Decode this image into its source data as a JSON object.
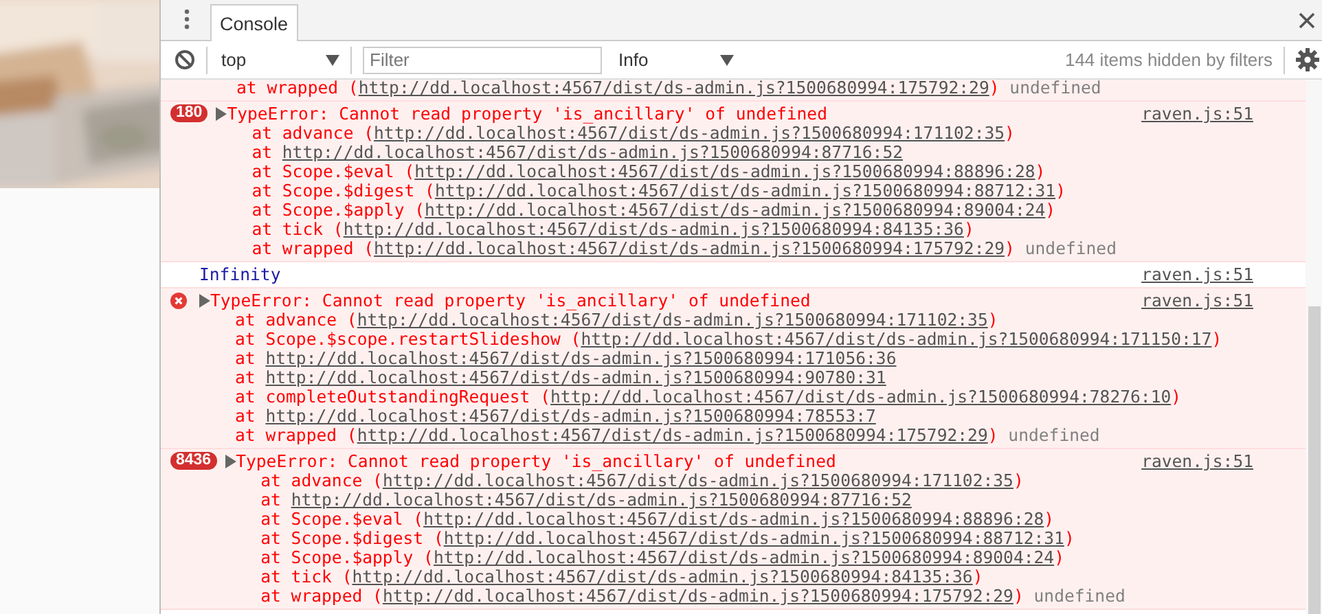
{
  "tabs": [
    {
      "label": "Console",
      "selected": true
    }
  ],
  "toolbar": {
    "context": "top",
    "filter_placeholder": "Filter",
    "level": "Info",
    "hidden_count": "144 items hidden by filters"
  },
  "messages": [
    {
      "kind": "partial",
      "frames": [
        {
          "text": "at wrapped (",
          "url": "http://dd.localhost:4567/dist/ds-admin.js?1500680994:175792:29",
          "close": ")"
        }
      ],
      "result": "undefined"
    },
    {
      "kind": "error",
      "count": "180",
      "message": "TypeError: Cannot read property 'is_ancillary' of undefined",
      "source": "raven.js:51",
      "frames": [
        {
          "text": "at advance (",
          "url": "http://dd.localhost:4567/dist/ds-admin.js?1500680994:171102:35",
          "close": ")"
        },
        {
          "text": "at ",
          "url": "http://dd.localhost:4567/dist/ds-admin.js?1500680994:87716:52"
        },
        {
          "text": "at Scope.$eval (",
          "url": "http://dd.localhost:4567/dist/ds-admin.js?1500680994:88896:28",
          "close": ")"
        },
        {
          "text": "at Scope.$digest (",
          "url": "http://dd.localhost:4567/dist/ds-admin.js?1500680994:88712:31",
          "close": ")"
        },
        {
          "text": "at Scope.$apply (",
          "url": "http://dd.localhost:4567/dist/ds-admin.js?1500680994:89004:24",
          "close": ")"
        },
        {
          "text": "at tick (",
          "url": "http://dd.localhost:4567/dist/ds-admin.js?1500680994:84135:36",
          "close": ")"
        },
        {
          "text": "at wrapped (",
          "url": "http://dd.localhost:4567/dist/ds-admin.js?1500680994:175792:29",
          "close": ")"
        }
      ],
      "result": "undefined"
    },
    {
      "kind": "log",
      "message": "Infinity",
      "source": "raven.js:51"
    },
    {
      "kind": "error",
      "message": "TypeError: Cannot read property 'is_ancillary' of undefined",
      "source": "raven.js:51",
      "frames": [
        {
          "text": "at advance (",
          "url": "http://dd.localhost:4567/dist/ds-admin.js?1500680994:171102:35",
          "close": ")"
        },
        {
          "text": "at Scope.$scope.restartSlideshow (",
          "url": "http://dd.localhost:4567/dist/ds-admin.js?1500680994:171150:17",
          "close": ")"
        },
        {
          "text": "at ",
          "url": "http://dd.localhost:4567/dist/ds-admin.js?1500680994:171056:36"
        },
        {
          "text": "at ",
          "url": "http://dd.localhost:4567/dist/ds-admin.js?1500680994:90780:31"
        },
        {
          "text": "at completeOutstandingRequest (",
          "url": "http://dd.localhost:4567/dist/ds-admin.js?1500680994:78276:10",
          "close": ")"
        },
        {
          "text": "at ",
          "url": "http://dd.localhost:4567/dist/ds-admin.js?1500680994:78553:7"
        },
        {
          "text": "at wrapped (",
          "url": "http://dd.localhost:4567/dist/ds-admin.js?1500680994:175792:29",
          "close": ")"
        }
      ],
      "result": "undefined"
    },
    {
      "kind": "error",
      "count": "8436",
      "message": "TypeError: Cannot read property 'is_ancillary' of undefined",
      "source": "raven.js:51",
      "frames": [
        {
          "text": "at advance (",
          "url": "http://dd.localhost:4567/dist/ds-admin.js?1500680994:171102:35",
          "close": ")"
        },
        {
          "text": "at ",
          "url": "http://dd.localhost:4567/dist/ds-admin.js?1500680994:87716:52"
        },
        {
          "text": "at Scope.$eval (",
          "url": "http://dd.localhost:4567/dist/ds-admin.js?1500680994:88896:28",
          "close": ")"
        },
        {
          "text": "at Scope.$digest (",
          "url": "http://dd.localhost:4567/dist/ds-admin.js?1500680994:88712:31",
          "close": ")"
        },
        {
          "text": "at Scope.$apply (",
          "url": "http://dd.localhost:4567/dist/ds-admin.js?1500680994:89004:24",
          "close": ")"
        },
        {
          "text": "at tick (",
          "url": "http://dd.localhost:4567/dist/ds-admin.js?1500680994:84135:36",
          "close": ")"
        },
        {
          "text": "at wrapped (",
          "url": "http://dd.localhost:4567/dist/ds-admin.js?1500680994:175792:29",
          "close": ")"
        }
      ],
      "result": "undefined"
    }
  ]
}
